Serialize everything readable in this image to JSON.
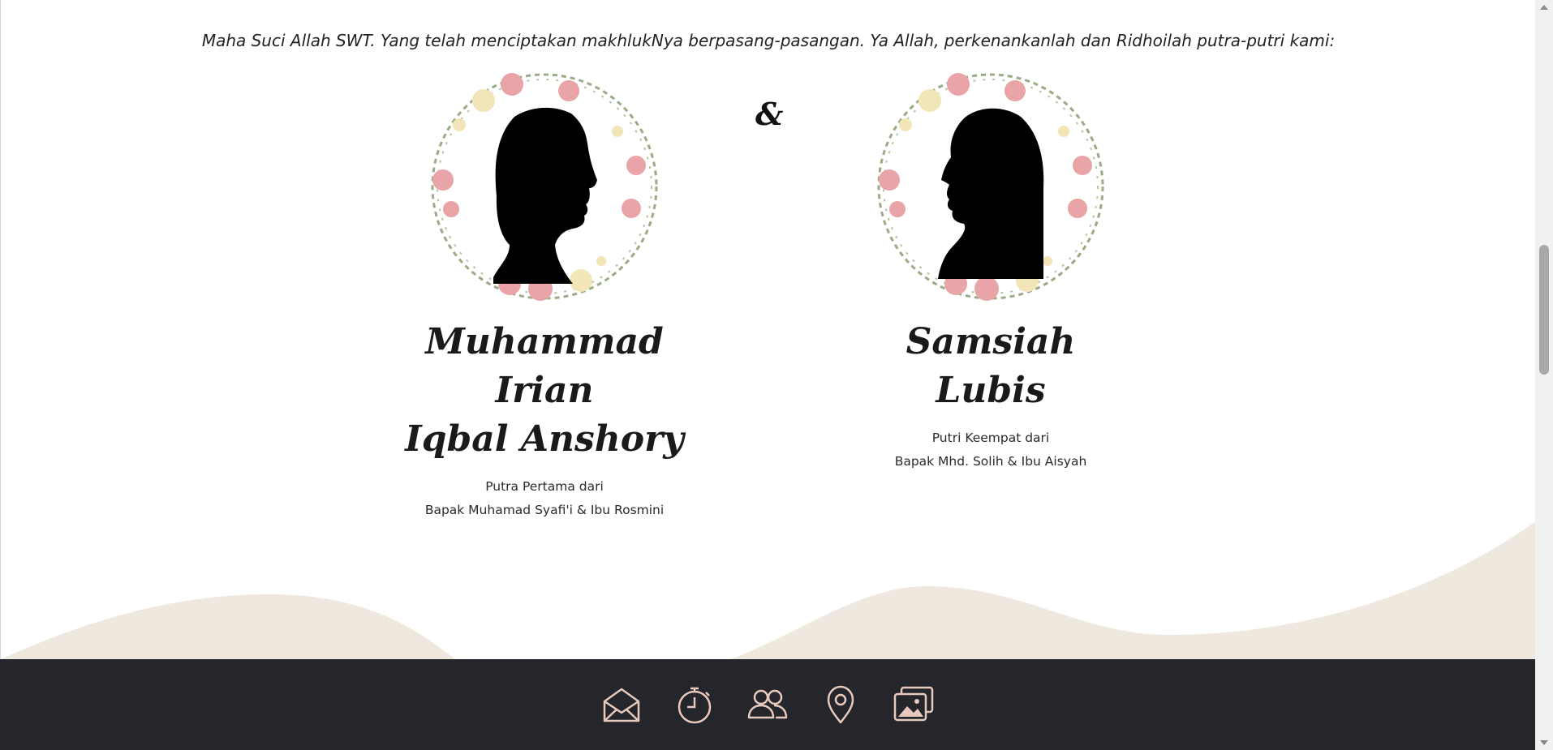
{
  "intro_text": "Maha Suci Allah SWT. Yang telah menciptakan makhlukNya berpasang-pasangan. Ya Allah, perkenankanlah dan Ridhoilah putra-putri kami:",
  "ampersand": "&",
  "groom": {
    "name_line1": "Muhammad Irian",
    "name_line2": "Iqbal Anshory",
    "relation": "Putra Pertama dari",
    "parents": "Bapak Muhamad Syafi'i & Ibu Rosmini"
  },
  "bride": {
    "name_line1": "Samsiah",
    "name_line2": "Lubis",
    "relation": "Putri Keempat dari",
    "parents": "Bapak Mhd. Solih & Ibu Aisyah"
  },
  "nav": [
    {
      "icon": "envelope-open-icon"
    },
    {
      "icon": "stopwatch-icon"
    },
    {
      "icon": "people-icon"
    },
    {
      "icon": "map-pin-icon"
    },
    {
      "icon": "gallery-icon"
    }
  ],
  "colors": {
    "wave": "#efe8df",
    "nav_bg": "#25262b",
    "nav_icon": "#e8c9bd",
    "rose": "#e8a4a6",
    "leaf": "#9aab86"
  }
}
